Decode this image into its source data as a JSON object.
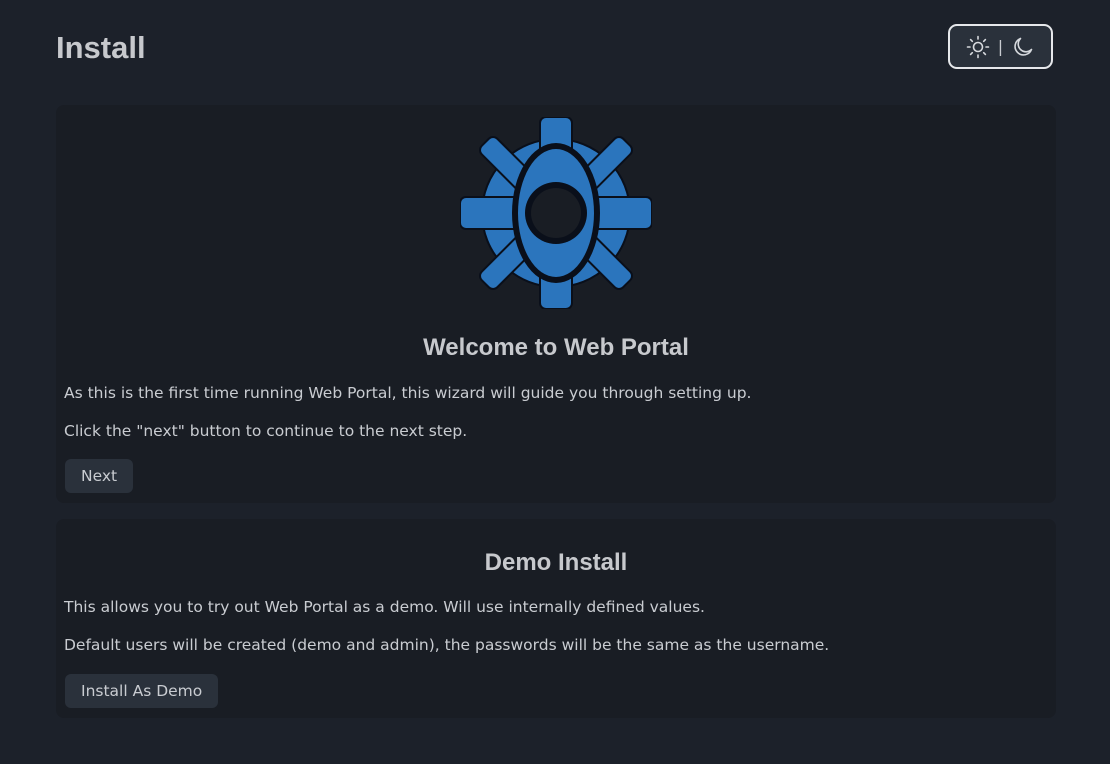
{
  "header": {
    "title": "Install",
    "theme_toggle": {
      "light_icon": "sun-icon",
      "separator": "|",
      "dark_icon": "moon-icon"
    }
  },
  "welcome": {
    "logo_icon": "gear-logo-icon",
    "title": "Welcome to Web Portal",
    "paragraph1": "As this is the first time running Web Portal, this wizard will guide you through setting up.",
    "paragraph2": "Click the \"next\" button to continue to the next step.",
    "next_label": "Next"
  },
  "demo": {
    "title": "Demo Install",
    "paragraph1": "This allows you to try out Web Portal as a demo. Will use internally defined values.",
    "paragraph2": "Default users will be created (demo and admin), the passwords will be the same as the username.",
    "install_label": "Install As Demo"
  },
  "colors": {
    "background": "#1c212a",
    "card": "#191d24",
    "button": "#2a313b",
    "logo_blue": "#2b75bd",
    "text": "#c9ccd1"
  }
}
